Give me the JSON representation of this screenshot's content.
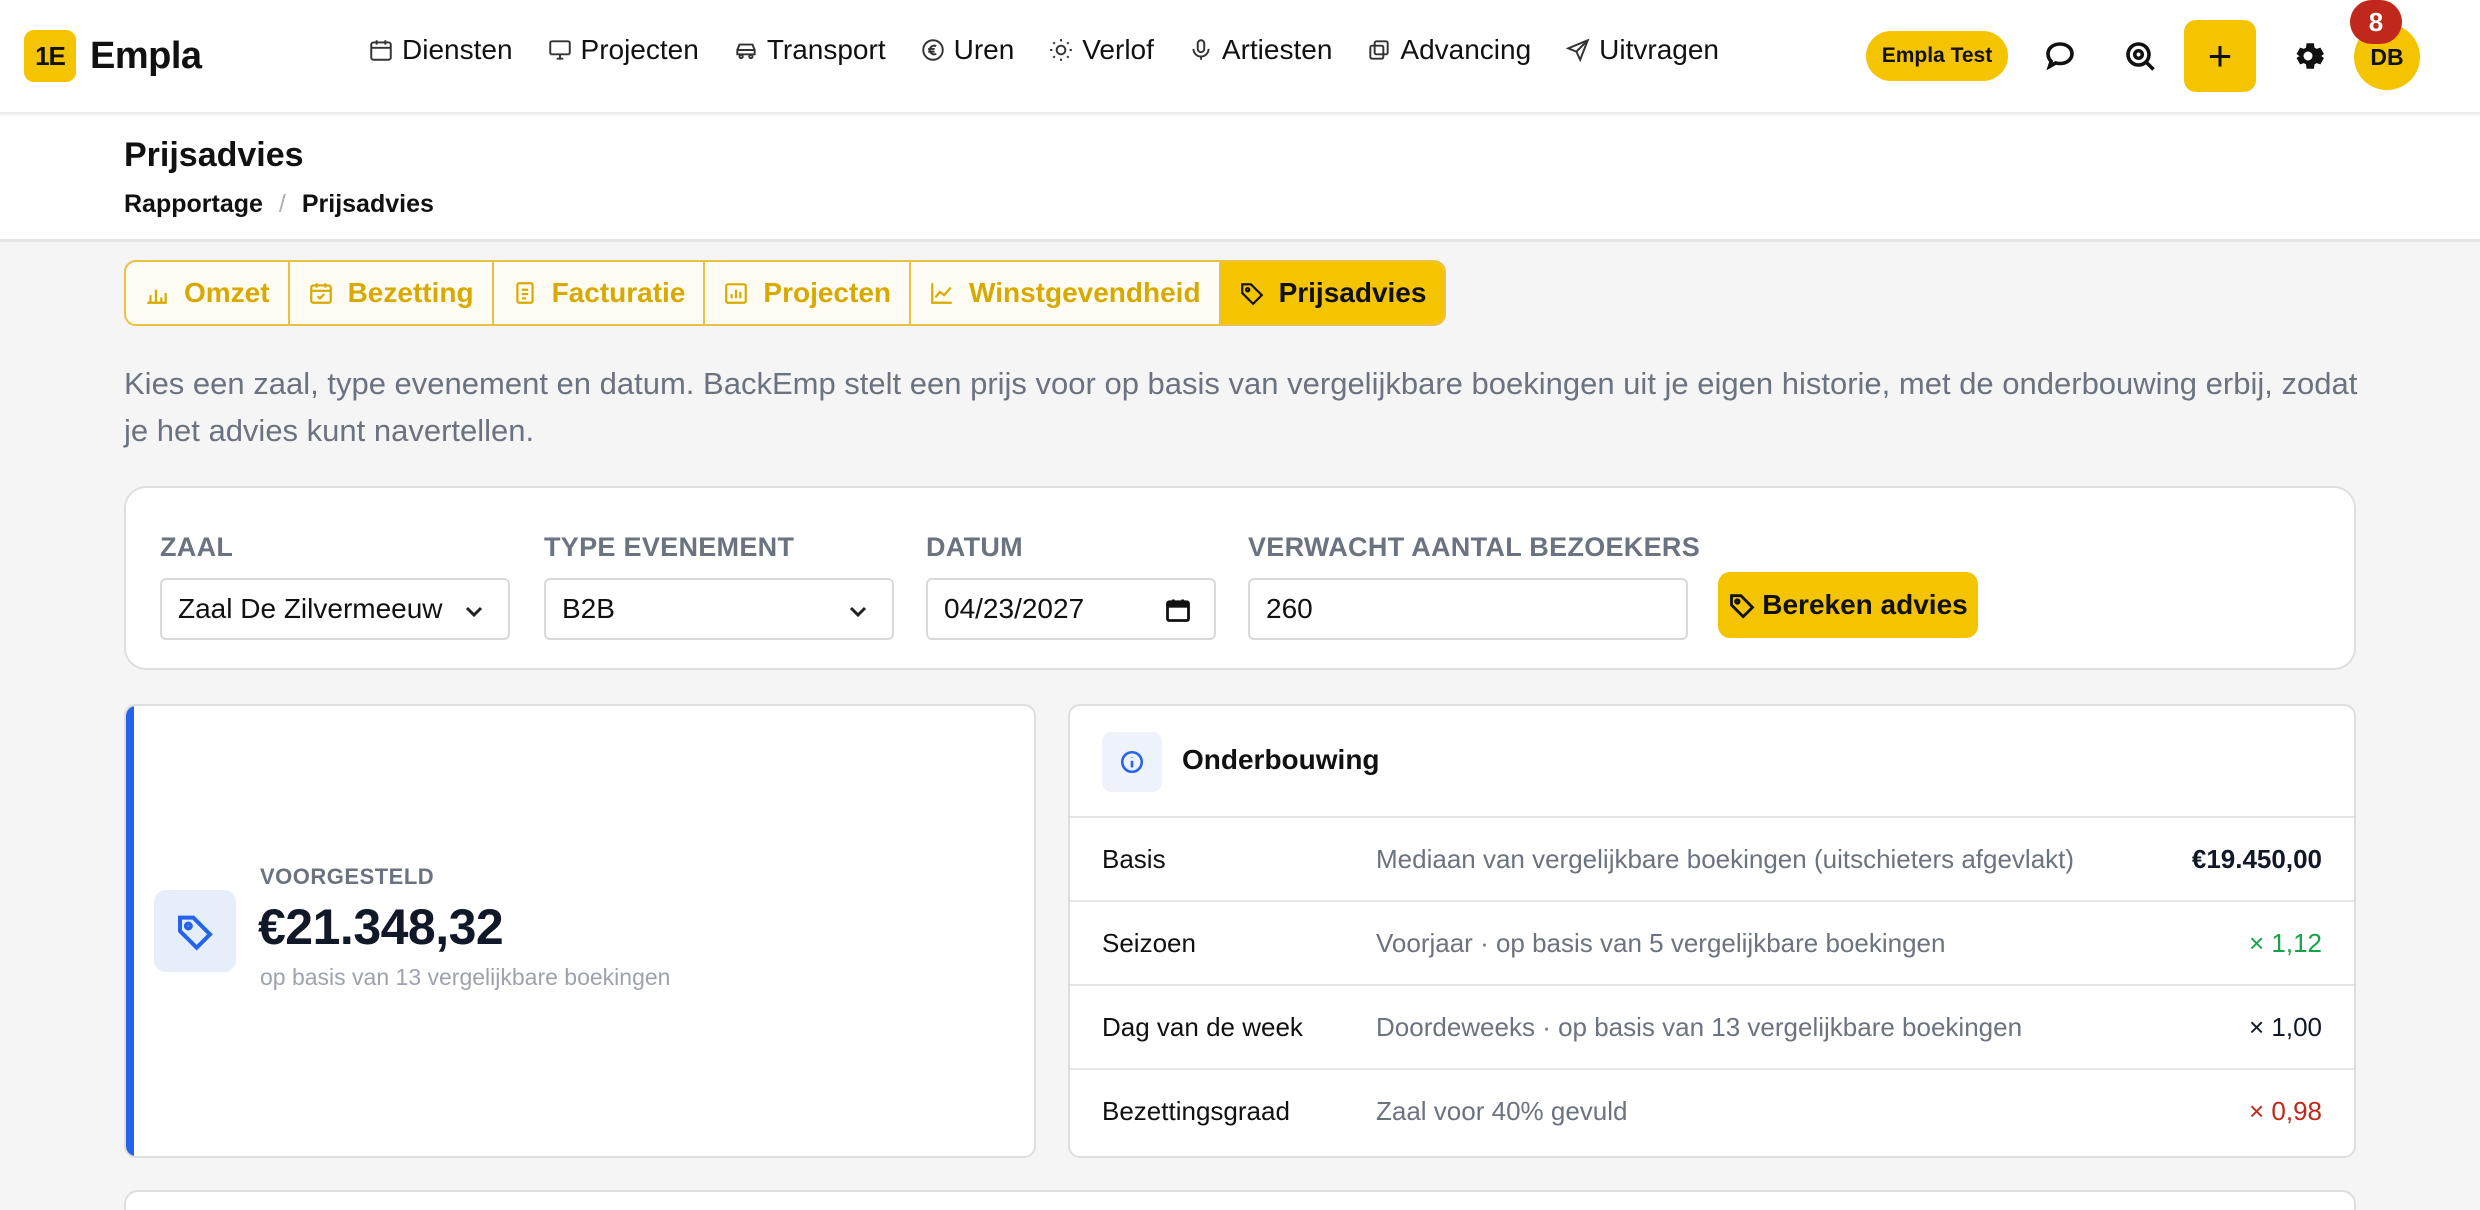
{
  "app": {
    "logo_mark": "1E",
    "logo_text": "Empla"
  },
  "nav": [
    {
      "label": "Diensten",
      "icon": "calendar-icon"
    },
    {
      "label": "Projecten",
      "icon": "monitor-icon"
    },
    {
      "label": "Transport",
      "icon": "car-icon"
    },
    {
      "label": "Uren",
      "icon": "euro-icon"
    },
    {
      "label": "Verlof",
      "icon": "sun-icon"
    },
    {
      "label": "Artiesten",
      "icon": "microphone-icon"
    },
    {
      "label": "Advancing",
      "icon": "copy-icon"
    },
    {
      "label": "Uitvragen",
      "icon": "send-icon"
    }
  ],
  "header": {
    "env_badge": "Empla Test",
    "add_label": "+",
    "avatar_initials": "DB",
    "notification_count": "8"
  },
  "page": {
    "title": "Prijsadvies",
    "breadcrumb": [
      "Rapportage",
      "/",
      "Prijsadvies"
    ]
  },
  "tabs": [
    {
      "label": "Omzet",
      "icon": "bar-chart-icon",
      "active": false
    },
    {
      "label": "Bezetting",
      "icon": "calendar-check-icon",
      "active": false
    },
    {
      "label": "Facturatie",
      "icon": "document-icon",
      "active": false
    },
    {
      "label": "Projecten",
      "icon": "building-chart-icon",
      "active": false
    },
    {
      "label": "Winstgevendheid",
      "icon": "line-chart-icon",
      "active": false
    },
    {
      "label": "Prijsadvies",
      "icon": "tag-icon",
      "active": true
    }
  ],
  "intro": "Kies een zaal, type evenement en datum. BackEmp stelt een prijs voor op basis van vergelijkbare boekingen uit je eigen historie, met de onderbouwing erbij, zodat je het advies kunt navertellen.",
  "form": {
    "zaal_label": "ZAAL",
    "zaal_value": "Zaal De Zilvermeeuw",
    "type_label": "TYPE EVENEMENT",
    "type_value": "B2B",
    "datum_label": "DATUM",
    "datum_value": "04/23/2027",
    "bezoekers_label": "VERWACHT AANTAL BEZOEKERS",
    "bezoekers_value": "260",
    "submit_label": "Bereken advies"
  },
  "suggestion": {
    "label": "VOORGESTELD",
    "price": "€21.348,32",
    "sub": "op basis van 13 vergelijkbare boekingen",
    "accent_color": "#2563eb"
  },
  "explanation": {
    "title": "Onderbouwing",
    "rows": [
      {
        "key": "Basis",
        "desc": "Mediaan van vergelijkbare boekingen (uitschieters afgevlakt)",
        "value": "€19.450,00",
        "color": "#111827"
      },
      {
        "key": "Seizoen",
        "desc": "Voorjaar · op basis van 5 vergelijkbare boekingen",
        "value": "× 1,12",
        "color": "#16a34a"
      },
      {
        "key": "Dag van de week",
        "desc": "Doordeweeks · op basis van 13 vergelijkbare boekingen",
        "value": "× 1,00",
        "color": "#111827"
      },
      {
        "key": "Bezettingsgraad",
        "desc": "Zaal voor 40% gevuld",
        "value": "× 0,98",
        "color": "#c0281b"
      }
    ]
  },
  "colors": {
    "brand": "#f5c400",
    "badge": "#c0281b",
    "muted": "#6b7280"
  }
}
